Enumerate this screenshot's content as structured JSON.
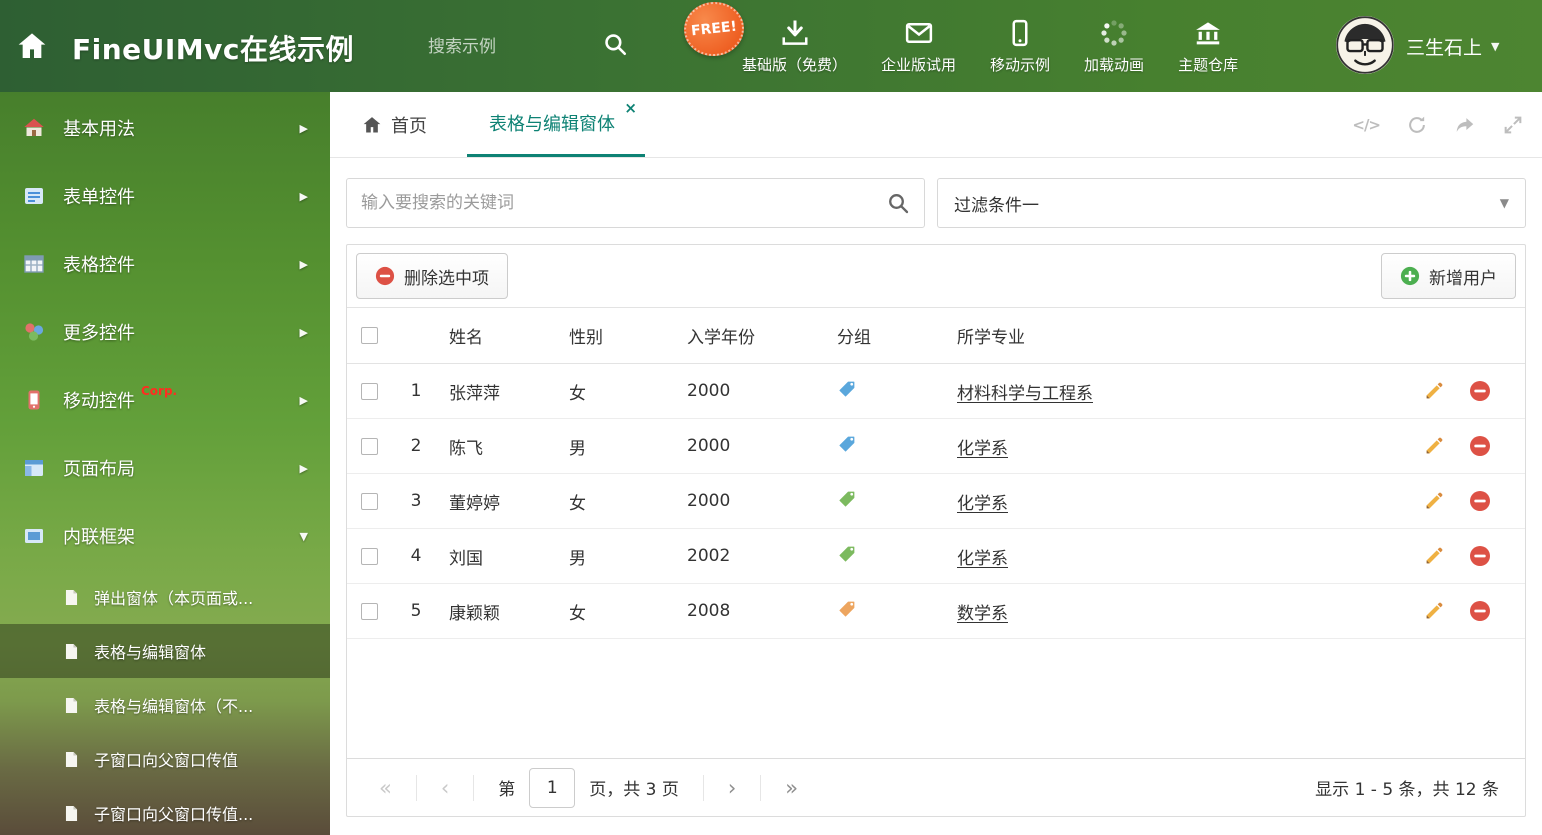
{
  "colors": {
    "accent": "#0e8274",
    "delete_red": "#dd5145",
    "add_green": "#4caf50",
    "pencil_orange": "#efb143"
  },
  "icon_glyphs": {
    "caret_down": "▼",
    "caret_right": "▶",
    "close": "×",
    "code": "</>"
  },
  "header": {
    "title": "FineUIMvc在线示例",
    "search_placeholder": "搜索示例",
    "free_badge": "FREE!",
    "nav_items": [
      {
        "label": "基础版（免费）",
        "icon": "download-icon"
      },
      {
        "label": "企业版试用",
        "icon": "mail-icon"
      },
      {
        "label": "移动示例",
        "icon": "mobile-icon"
      },
      {
        "label": "加载动画",
        "icon": "spinner-icon"
      },
      {
        "label": "主题仓库",
        "icon": "bank-icon"
      }
    ],
    "username": "三生石上"
  },
  "sidebar": {
    "items": [
      {
        "label": "基本用法",
        "icon": "house-icon",
        "state": "collapsed"
      },
      {
        "label": "表单控件",
        "icon": "form-icon",
        "state": "collapsed"
      },
      {
        "label": "表格控件",
        "icon": "grid-icon",
        "state": "collapsed"
      },
      {
        "label": "更多控件",
        "icon": "widgets-icon",
        "state": "collapsed"
      },
      {
        "label": "移动控件",
        "icon": "phone-icon",
        "badge": "Corp.",
        "state": "collapsed"
      },
      {
        "label": "页面布局",
        "icon": "layout-icon",
        "state": "collapsed"
      },
      {
        "label": "内联框架",
        "icon": "frame-icon",
        "state": "expanded"
      }
    ],
    "subitems": [
      {
        "label": "弹出窗体（本页面或...",
        "active": false
      },
      {
        "label": "表格与编辑窗体",
        "active": true
      },
      {
        "label": "表格与编辑窗体（不...",
        "active": false
      },
      {
        "label": "子窗口向父窗口传值",
        "active": false
      },
      {
        "label": "子窗口向父窗口传值...",
        "active": false
      }
    ]
  },
  "tabs": {
    "home_label": "首页",
    "active_label": "表格与编辑窗体"
  },
  "filter_bar": {
    "search_placeholder": "输入要搜索的关键词",
    "dropdown_value": "过滤条件一"
  },
  "toolbar": {
    "delete_label": "删除选中项",
    "add_label": "新增用户"
  },
  "table": {
    "columns": [
      "姓名",
      "性别",
      "入学年份",
      "分组",
      "所学专业"
    ],
    "rows": [
      {
        "index": "1",
        "name": "张萍萍",
        "gender": "女",
        "year": "2000",
        "tag_color": "#5aa7dc",
        "major": "材料科学与工程系"
      },
      {
        "index": "2",
        "name": "陈飞",
        "gender": "男",
        "year": "2000",
        "tag_color": "#5aa7dc",
        "major": "化学系"
      },
      {
        "index": "3",
        "name": "董婷婷",
        "gender": "女",
        "year": "2000",
        "tag_color": "#7cba5f",
        "major": "化学系"
      },
      {
        "index": "4",
        "name": "刘国",
        "gender": "男",
        "year": "2002",
        "tag_color": "#7cba5f",
        "major": "化学系"
      },
      {
        "index": "5",
        "name": "康颖颖",
        "gender": "女",
        "year": "2008",
        "tag_color": "#eda55f",
        "major": "数学系"
      }
    ]
  },
  "pagination": {
    "first": "«",
    "prev": "‹",
    "next": "›",
    "last": "»",
    "page_prefix": "第",
    "page_value": "1",
    "page_suffix": "页，共 3 页",
    "summary": "显示 1 - 5 条，共 12 条"
  }
}
